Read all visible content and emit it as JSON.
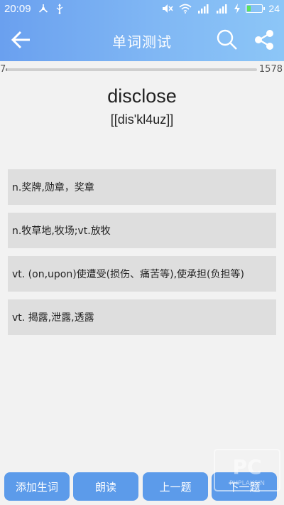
{
  "status_bar": {
    "time": "20:09",
    "battery_pct": "24",
    "icons": [
      "usb-tether-icon",
      "usb-icon",
      "mute-icon",
      "wifi-icon",
      "signal-icon",
      "signal-icon",
      "charging-icon",
      "battery-icon"
    ]
  },
  "app_bar": {
    "title": "单词测试",
    "back_icon": "arrow-left-icon",
    "search_icon": "search-icon",
    "share_icon": "share-icon"
  },
  "progress": {
    "current": "7",
    "total": "1578",
    "fraction": 0.0044
  },
  "question": {
    "word": "disclose",
    "phonetic": "[[dis'kl4uz]]"
  },
  "options": [
    "n.奖牌,勋章，奖章",
    "n.牧草地,牧场;vt.放牧",
    "vt. (on,upon)使遭受(损伤、痛苦等),使承担(负担等)",
    "vt. 揭露,泄露,透露"
  ],
  "bottom_buttons": {
    "add_word": "添加生词",
    "read_aloud": "朗读",
    "previous": "上一题",
    "next": "下一题"
  },
  "colors": {
    "header_gradient_start": "#6aa0ef",
    "header_gradient_end": "#8cc6f7",
    "button_blue": "#5c9bea",
    "option_bg": "#dedede",
    "page_bg": "#f2f2f2"
  }
}
